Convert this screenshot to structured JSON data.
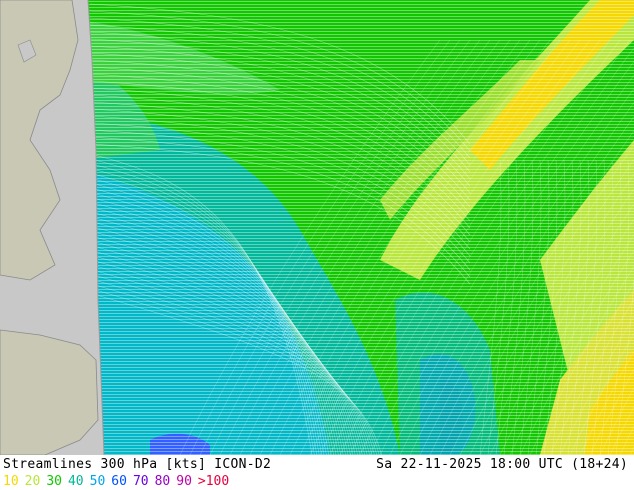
{
  "header": {
    "title": "Streamlines 300 hPa [kts] ICON-D2",
    "valid_time": "Sa 22-11-2025 18:00 UTC (18+24)"
  },
  "legend": {
    "items": [
      {
        "label": "10",
        "color": "#f5d800"
      },
      {
        "label": "20",
        "color": "#b8e63a"
      },
      {
        "label": "30",
        "color": "#11c800"
      },
      {
        "label": "40",
        "color": "#00b89a"
      },
      {
        "label": "50",
        "color": "#00a6e8"
      },
      {
        "label": "60",
        "color": "#0050ff"
      },
      {
        "label": "70",
        "color": "#6a00e6"
      },
      {
        "label": "80",
        "color": "#9a00c8"
      },
      {
        "label": "90",
        "color": "#c000a8"
      },
      {
        "label": ">100",
        "color": "#e8003c"
      }
    ]
  },
  "map": {
    "land_color": "#c8c8b4",
    "outside_color": "#c8c8c8",
    "sea_outline_color": "#8a8a8a"
  }
}
